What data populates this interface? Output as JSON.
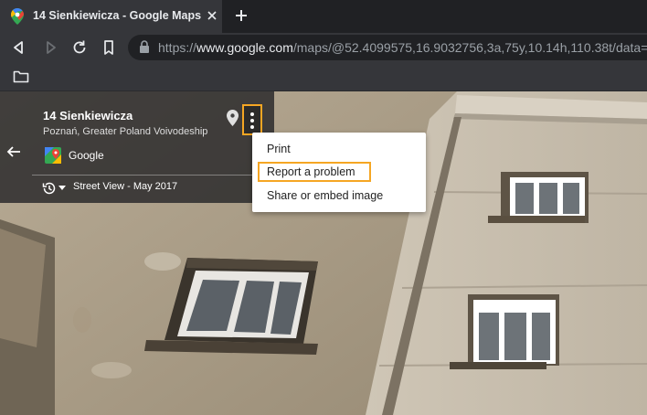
{
  "browser": {
    "tab_title": "14 Sienkiewicza - Google Maps",
    "url_prefix": "https://",
    "url_host": "www.google.com",
    "url_path": "/maps/@52.4099575,16.9032756,3a,75y,10.14h,110.38t/data="
  },
  "place": {
    "title": "14 Sienkiewicza",
    "subtitle": "Poznań, Greater Poland Voivodeship",
    "provider": "Google",
    "street_view_date": "Street View - May 2017"
  },
  "menu": {
    "items": [
      {
        "label": "Print"
      },
      {
        "label": "Report a problem"
      },
      {
        "label": "Share or embed image"
      }
    ]
  },
  "colors": {
    "highlight": "#f5a623",
    "chrome_dark": "#202124",
    "chrome_mid": "#35363a"
  },
  "icons": [
    "maps-favicon-icon",
    "close-icon",
    "plus-icon",
    "back-icon",
    "forward-icon",
    "reload-icon",
    "bookmark-icon",
    "lock-icon",
    "folder-icon",
    "arrow-left-icon",
    "google-maps-icon",
    "history-icon",
    "chevron-down-icon",
    "location-pin-icon",
    "more-vert-icon"
  ]
}
